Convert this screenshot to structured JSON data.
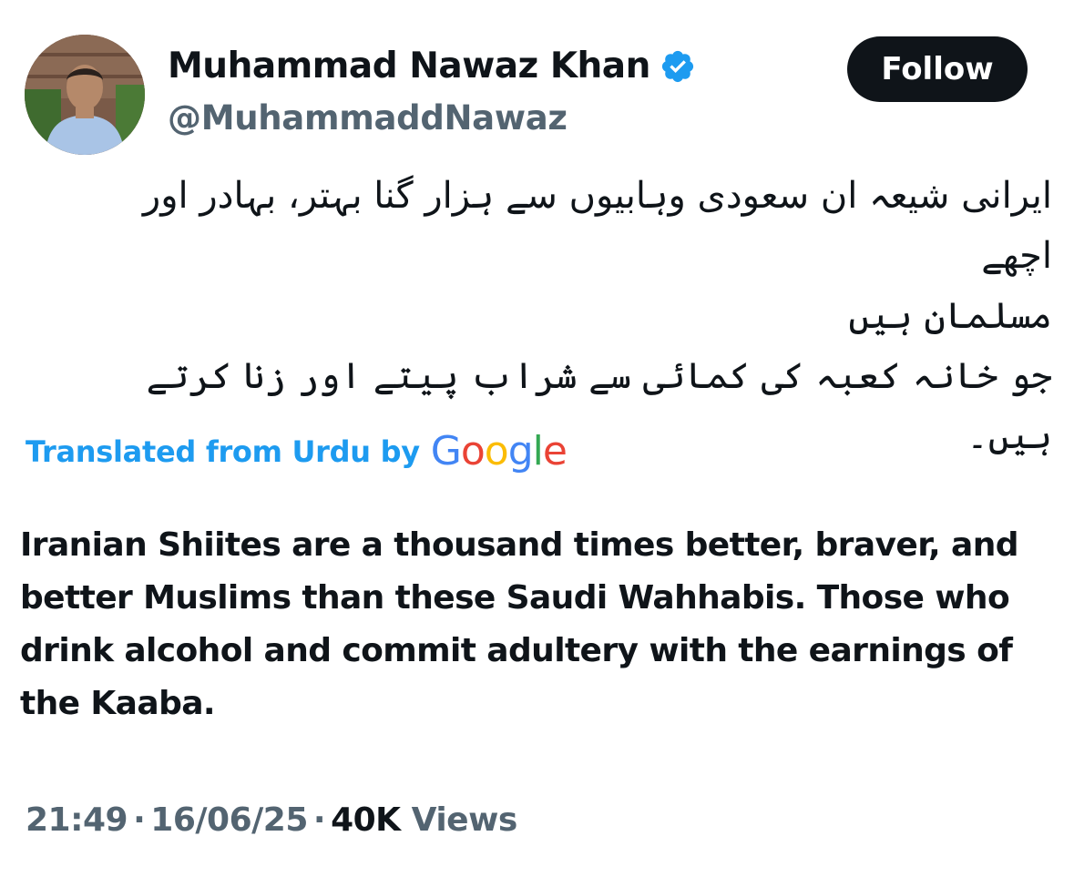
{
  "author": {
    "display_name": "Muhammad Nawaz Khan",
    "handle": "@MuhammaddNawaz",
    "verified_icon": "verified-badge-icon",
    "accent_color": "#1d9bf0"
  },
  "follow_button": {
    "label": "Follow"
  },
  "tweet": {
    "urdu_text": "ایرانی شیعہ ان سعودی وہابیوں سے ہزار گنا بہتر، بہادر اور اچھے\nمسلمان ہیں\nجو خانہ کعبہ کی کمائی سے شراب پیتے اور زنا کرتے ہیں۔",
    "translated_label": "Translated from Urdu by",
    "translator_logo": "Google",
    "translation": "Iranian Shiites are a thousand times better, braver, and better Muslims than these Saudi Wahhabis. Those who drink alcohol and commit adultery with the earnings of the Kaaba."
  },
  "meta": {
    "time": "21:49",
    "separator": "·",
    "date": "16/06/25",
    "views_count": "40K",
    "views_label": "Views"
  }
}
